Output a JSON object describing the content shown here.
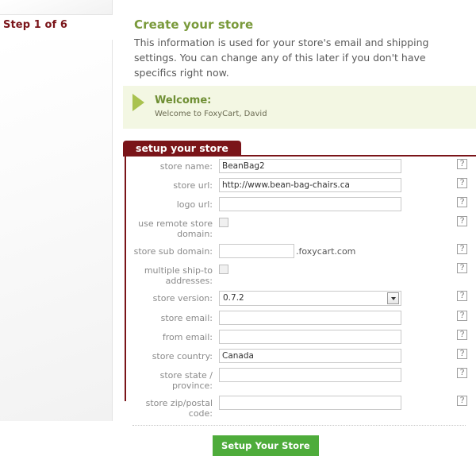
{
  "sidebar": {
    "step_label": "Step 1 of 6"
  },
  "header": {
    "title": "Create your store",
    "description": "This information is used for your store's email and shipping settings. You can change any of this later if you don't have specifics right now."
  },
  "welcome": {
    "icon": "triangle-right-icon",
    "title": "Welcome:",
    "subtitle": "Welcome to FoxyCart, David"
  },
  "form": {
    "tab_label": "setup your store",
    "help_label": "?",
    "sub_domain_suffix": ".foxycart.com",
    "submit_label": "Setup Your Store",
    "fields": [
      {
        "label": "store name:",
        "value": "BeanBag2",
        "placeholder": ""
      },
      {
        "label": "store url:",
        "value": "http://www.bean-bag-chairs.ca",
        "placeholder": ""
      },
      {
        "label": "logo url:",
        "value": "",
        "placeholder": ""
      },
      {
        "label": "use remote store domain:",
        "value": "",
        "placeholder": ""
      },
      {
        "label": "store sub domain:",
        "value": "",
        "placeholder": ""
      },
      {
        "label": "multiple ship-to addresses:",
        "value": "",
        "placeholder": ""
      },
      {
        "label": "store version:",
        "value": "0.7.2",
        "placeholder": ""
      },
      {
        "label": "store email:",
        "value": "",
        "placeholder": ""
      },
      {
        "label": "from email:",
        "value": "",
        "placeholder": ""
      },
      {
        "label": "store country:",
        "value": "Canada",
        "placeholder": ""
      },
      {
        "label": "store state / province:",
        "value": "",
        "placeholder": ""
      },
      {
        "label": "store zip/postal code:",
        "value": "",
        "placeholder": ""
      }
    ]
  },
  "colors": {
    "brand_maroon": "#7a1419",
    "accent_green": "#7a9a3b",
    "button_green": "#4eac3b",
    "welcome_bg": "#f3f7e3"
  }
}
